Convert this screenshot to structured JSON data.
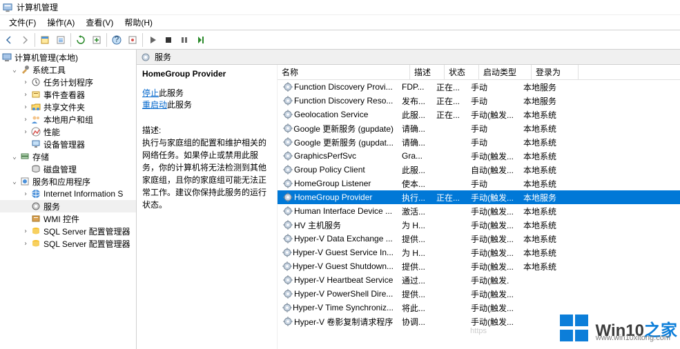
{
  "title": "计算机管理",
  "menu": {
    "file": "文件(F)",
    "action": "操作(A)",
    "view": "查看(V)",
    "help": "帮助(H)"
  },
  "tree": {
    "root": "计算机管理(本地)",
    "system_tools": "系统工具",
    "task_scheduler": "任务计划程序",
    "event_viewer": "事件查看器",
    "shared_folders": "共享文件夹",
    "local_users": "本地用户和组",
    "performance": "性能",
    "device_manager": "设备管理器",
    "storage": "存储",
    "disk_mgmt": "磁盘管理",
    "services_apps": "服务和应用程序",
    "iis": "Internet Information S",
    "services": "服务",
    "wmi": "WMI 控件",
    "sqlcfg1": "SQL Server 配置管理器",
    "sqlcfg2": "SQL Server 配置管理器"
  },
  "panel_header": "服务",
  "detail": {
    "title": "HomeGroup Provider",
    "stop": "停止",
    "stop_suffix": "此服务",
    "restart": "重启动",
    "restart_suffix": "此服务",
    "desc_label": "描述:",
    "desc": "执行与家庭组的配置和维护相关的网络任务。如果停止或禁用此服务，你的计算机将无法检测到其他家庭组，且你的家庭组可能无法正常工作。建议你保持此服务的运行状态。"
  },
  "columns": {
    "name": "名称",
    "desc": "描述",
    "status": "状态",
    "startup": "启动类型",
    "logon": "登录为"
  },
  "services": [
    {
      "name": "Function Discovery Provi...",
      "desc": "FDP...",
      "status": "正在...",
      "startup": "手动",
      "logon": "本地服务",
      "sel": false
    },
    {
      "name": "Function Discovery Reso...",
      "desc": "发布...",
      "status": "正在...",
      "startup": "手动",
      "logon": "本地服务",
      "sel": false
    },
    {
      "name": "Geolocation Service",
      "desc": "此服...",
      "status": "正在...",
      "startup": "手动(触发...",
      "logon": "本地系统",
      "sel": false
    },
    {
      "name": "Google 更新服务 (gupdate)",
      "desc": "请确...",
      "status": "",
      "startup": "手动",
      "logon": "本地系统",
      "sel": false
    },
    {
      "name": "Google 更新服务 (gupdat...",
      "desc": "请确...",
      "status": "",
      "startup": "手动",
      "logon": "本地系统",
      "sel": false
    },
    {
      "name": "GraphicsPerfSvc",
      "desc": "Gra...",
      "status": "",
      "startup": "手动(触发...",
      "logon": "本地系统",
      "sel": false
    },
    {
      "name": "Group Policy Client",
      "desc": "此服...",
      "status": "",
      "startup": "自动(触发...",
      "logon": "本地系统",
      "sel": false
    },
    {
      "name": "HomeGroup Listener",
      "desc": "使本...",
      "status": "",
      "startup": "手动",
      "logon": "本地系统",
      "sel": false
    },
    {
      "name": "HomeGroup Provider",
      "desc": "执行...",
      "status": "正在...",
      "startup": "手动(触发...",
      "logon": "本地服务",
      "sel": true
    },
    {
      "name": "Human Interface Device ...",
      "desc": "激活...",
      "status": "",
      "startup": "手动(触发...",
      "logon": "本地系统",
      "sel": false
    },
    {
      "name": "HV 主机服务",
      "desc": "为 H...",
      "status": "",
      "startup": "手动(触发...",
      "logon": "本地系统",
      "sel": false
    },
    {
      "name": "Hyper-V Data Exchange ...",
      "desc": "提供...",
      "status": "",
      "startup": "手动(触发...",
      "logon": "本地系统",
      "sel": false
    },
    {
      "name": "Hyper-V Guest Service In...",
      "desc": "为 H...",
      "status": "",
      "startup": "手动(触发...",
      "logon": "本地系统",
      "sel": false
    },
    {
      "name": "Hyper-V Guest Shutdown...",
      "desc": "提供...",
      "status": "",
      "startup": "手动(触发...",
      "logon": "本地系统",
      "sel": false
    },
    {
      "name": "Hyper-V Heartbeat Service",
      "desc": "通过...",
      "status": "",
      "startup": "手动(触发.",
      "logon": "",
      "sel": false
    },
    {
      "name": "Hyper-V PowerShell Dire...",
      "desc": "提供...",
      "status": "",
      "startup": "手动(触发...",
      "logon": "",
      "sel": false
    },
    {
      "name": "Hyper-V Time Synchroniz...",
      "desc": "将此...",
      "status": "",
      "startup": "手动(触发...",
      "logon": "",
      "sel": false
    },
    {
      "name": "Hyper-V 卷影复制请求程序",
      "desc": "协调...",
      "status": "",
      "startup": "手动(触发...",
      "logon": "",
      "sel": false
    }
  ],
  "watermark": {
    "brand": "Win10",
    "suffix": "之家",
    "url": "www.win10xitong.com",
    "hint": "https"
  }
}
